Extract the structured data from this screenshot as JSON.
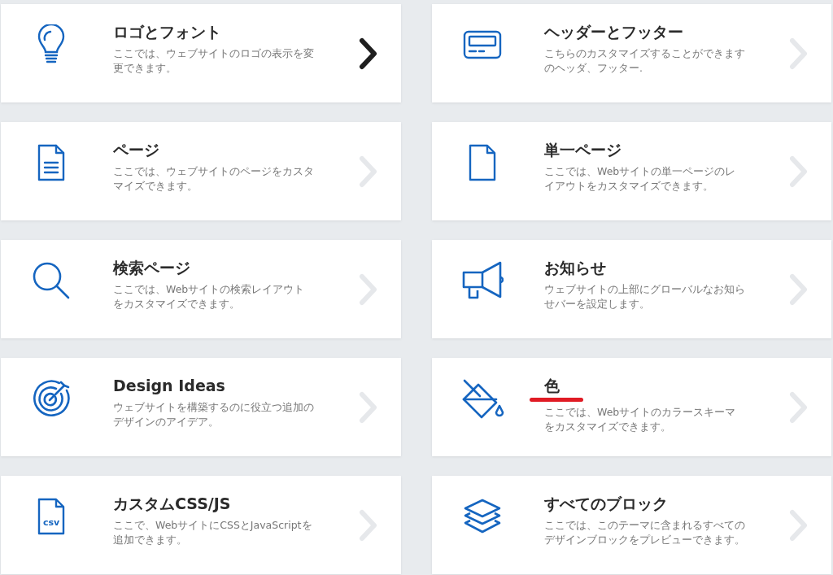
{
  "cards": [
    {
      "kind": "bulb",
      "title": "ロゴとフォント",
      "description": "ここでは、ウェブサイトのロゴの表示を変更できます。",
      "selected": true,
      "underlined": false
    },
    {
      "kind": "header",
      "title": "ヘッダーとフッター",
      "description": "こちらのカスタマイズすることができますのヘッダ、フッター.",
      "selected": false,
      "underlined": false
    },
    {
      "kind": "document",
      "title": "ページ",
      "description": "ここでは、ウェブサイトのページをカスタマイズできます。",
      "selected": false,
      "underlined": false
    },
    {
      "kind": "page",
      "title": "単一ページ",
      "description": "ここでは、Webサイトの単一ページのレイアウトをカスタマイズできます。",
      "selected": false,
      "underlined": false
    },
    {
      "kind": "search",
      "title": "検索ページ",
      "description": "ここでは、Webサイトの検索レイアウトをカスタマイズできます。",
      "selected": false,
      "underlined": false
    },
    {
      "kind": "megaphone",
      "title": "お知らせ",
      "description": "ウェブサイトの上部にグローバルなお知らせバーを設定します。",
      "selected": false,
      "underlined": false
    },
    {
      "kind": "target",
      "title": "Design Ideas",
      "description": "ウェブサイトを構築するのに役立つ追加のデザインのアイデア。",
      "selected": false,
      "underlined": false
    },
    {
      "kind": "bucket",
      "title": "色",
      "description": "ここでは、Webサイトのカラースキーマをカスタマイズできます。",
      "selected": false,
      "underlined": true
    },
    {
      "kind": "file",
      "icon_label": "csv",
      "title": "カスタムCSS/JS",
      "description": "ここで、WebサイトにCSSとJavaScriptを追加できます。",
      "selected": false,
      "underlined": false
    },
    {
      "kind": "layers",
      "title": "すべてのブロック",
      "description": "ここでは、このテーマに含まれるすべてのデザインブロックをプレビューできます。",
      "selected": false,
      "underlined": false
    }
  ]
}
